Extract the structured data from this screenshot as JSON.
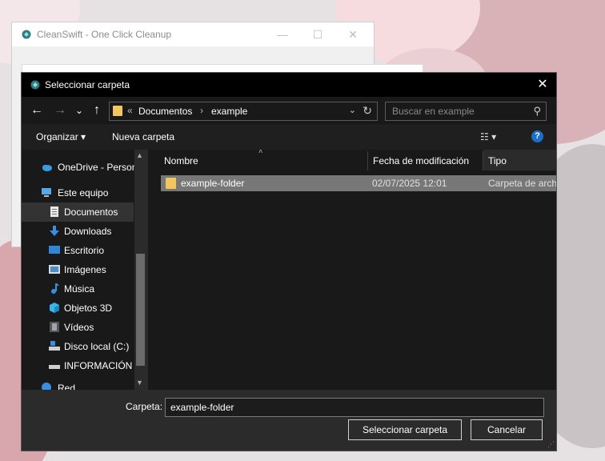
{
  "background_window": {
    "title": "CleanSwift - One Click Cleanup",
    "minimize": "—",
    "maximize": "☐",
    "close": "✕"
  },
  "dialog": {
    "title": "Seleccionar carpeta",
    "close": "✕"
  },
  "nav": {
    "back": "←",
    "forward": "→",
    "recent": "⌄",
    "up": "↑"
  },
  "address": {
    "overflow": "«",
    "crumbs": [
      "Documentos",
      "example"
    ],
    "separator": "›",
    "dropdown": "⌄",
    "refresh": "↻"
  },
  "search": {
    "placeholder": "Buscar en example",
    "icon": "⚲"
  },
  "toolbar": {
    "organize": "Organizar ▾",
    "new_folder": "Nueva carpeta",
    "view": "☷ ▾",
    "help": "?"
  },
  "sidebar": {
    "items": [
      {
        "label": "OneDrive - Person",
        "icon": "cloud-icon"
      },
      {
        "label": "Este equipo",
        "icon": "computer-icon"
      },
      {
        "label": "Documentos",
        "icon": "documents-icon"
      },
      {
        "label": "Downloads",
        "icon": "download-icon"
      },
      {
        "label": "Escritorio",
        "icon": "desktop-icon"
      },
      {
        "label": "Imágenes",
        "icon": "pictures-icon"
      },
      {
        "label": "Música",
        "icon": "music-icon"
      },
      {
        "label": "Objetos 3D",
        "icon": "3d-objects-icon"
      },
      {
        "label": "Vídeos",
        "icon": "videos-icon"
      },
      {
        "label": "Disco local (C:)",
        "icon": "drive-icon"
      },
      {
        "label": "INFORMACIÓN",
        "icon": "drive-icon"
      },
      {
        "label": "Red",
        "icon": "network-icon"
      }
    ],
    "selected": "Documentos"
  },
  "file_list": {
    "columns": [
      "Nombre",
      "Fecha de modificación",
      "Tipo"
    ],
    "rows": [
      {
        "name": "example-folder",
        "modified": "02/07/2025 12:01",
        "type": "Carpeta de archi"
      }
    ]
  },
  "footer": {
    "folder_label": "Carpeta:",
    "folder_value": "example-folder",
    "select_button": "Seleccionar carpeta",
    "cancel_button": "Cancelar"
  },
  "colors": {
    "dialog_bg": "#2b2b2b",
    "pane_bg": "#191919",
    "selection": "#777777",
    "folder_yellow": "#f3c55e",
    "accent_blue": "#1d6ec7"
  }
}
